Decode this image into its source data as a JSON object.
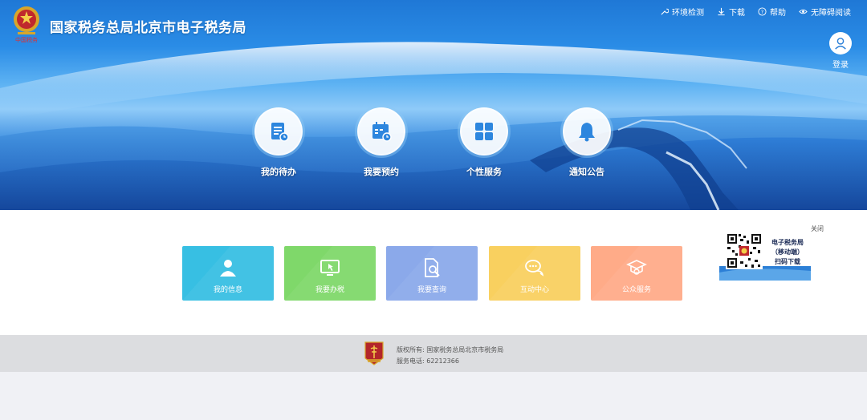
{
  "header": {
    "title": "国家税务总局北京市电子税务局",
    "logo_caption": "中国税务"
  },
  "topnav": [
    {
      "label": "环境检测",
      "icon": "wrench-icon"
    },
    {
      "label": "下载",
      "icon": "download-icon"
    },
    {
      "label": "帮助",
      "icon": "help-icon"
    },
    {
      "label": "无障碍阅读",
      "icon": "eye-icon"
    }
  ],
  "login": {
    "label": "登录"
  },
  "quick_entries": [
    {
      "label": "我的待办",
      "icon": "todo-list-icon"
    },
    {
      "label": "我要预约",
      "icon": "calendar-clock-icon"
    },
    {
      "label": "个性服务",
      "icon": "grid-icon"
    },
    {
      "label": "通知公告",
      "icon": "bell-icon"
    }
  ],
  "tiles": [
    {
      "label": "我的信息",
      "icon": "user-icon",
      "color": "#37bfe3"
    },
    {
      "label": "我要办税",
      "icon": "monitor-icon",
      "color": "#7fd86a"
    },
    {
      "label": "我要查询",
      "icon": "search-doc-icon",
      "color": "#8ba9ea"
    },
    {
      "label": "互动中心",
      "icon": "chat-icon",
      "color": "#f9d05f"
    },
    {
      "label": "公众服务",
      "icon": "graduation-icon",
      "color": "#ffab88"
    }
  ],
  "qr_promo": {
    "close": "关闭",
    "line1": "电子税务局",
    "line2": "（移动端）",
    "line3": "扫码下载"
  },
  "footer": {
    "copyright": "版权所有: 国家税务总局北京市税务局",
    "phone": "服务电话: 62212366"
  }
}
